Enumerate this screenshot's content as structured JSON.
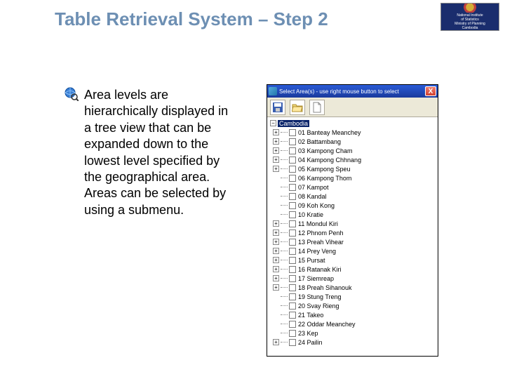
{
  "title": "Table Retrieval System – Step 2",
  "logo": {
    "line1": "National Institute",
    "line2": "of Statistics",
    "line3": "Ministry of Planning",
    "line4": "Cambodia"
  },
  "body_text": "Area levels are hierarchically displayed in a tree view that can be expanded down to the lowest level specified by the geographical area. Areas can be selected by using a submenu.",
  "dialog": {
    "title": "Select Area(s) - use right mouse button to select",
    "close": "X",
    "root": "Cambodia",
    "items": [
      {
        "exp": true,
        "label": "01 Banteay Meanchey"
      },
      {
        "exp": true,
        "label": "02 Battambang"
      },
      {
        "exp": true,
        "label": "03 Kampong Cham"
      },
      {
        "exp": true,
        "label": "04 Kampong Chhnang"
      },
      {
        "exp": true,
        "label": "05 Kampong Speu"
      },
      {
        "exp": false,
        "label": "06 Kampong Thom"
      },
      {
        "exp": false,
        "label": "07 Kampot"
      },
      {
        "exp": false,
        "label": "08 Kandal"
      },
      {
        "exp": false,
        "label": "09 Koh Kong"
      },
      {
        "exp": false,
        "label": "10 Kratie"
      },
      {
        "exp": true,
        "label": "11 Mondul Kiri"
      },
      {
        "exp": true,
        "label": "12 Phnom Penh"
      },
      {
        "exp": true,
        "label": "13 Preah Vihear"
      },
      {
        "exp": true,
        "label": "14 Prey Veng"
      },
      {
        "exp": true,
        "label": "15 Pursat"
      },
      {
        "exp": true,
        "label": "16 Ratanak Kiri"
      },
      {
        "exp": true,
        "label": "17 Siemreap"
      },
      {
        "exp": true,
        "label": "18 Preah Sihanouk"
      },
      {
        "exp": false,
        "label": "19 Stung Treng"
      },
      {
        "exp": false,
        "label": "20 Svay Rieng"
      },
      {
        "exp": false,
        "label": "21 Takeo"
      },
      {
        "exp": false,
        "label": "22 Oddar Meanchey"
      },
      {
        "exp": false,
        "label": "23 Kep"
      },
      {
        "exp": true,
        "label": "24 Pailin"
      }
    ]
  }
}
